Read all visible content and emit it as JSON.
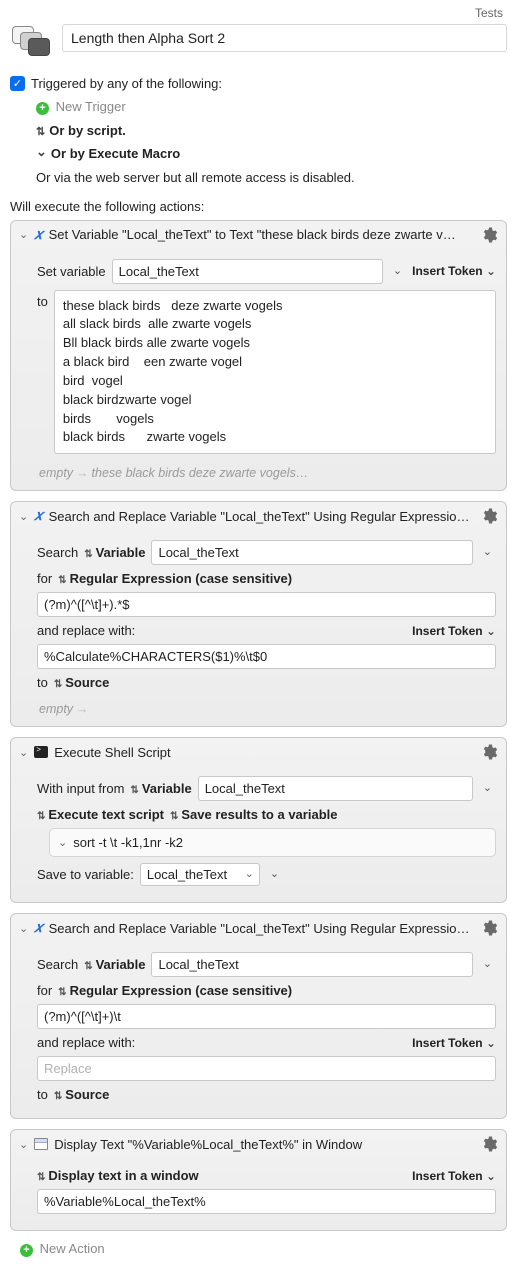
{
  "topbar": {
    "tests": "Tests"
  },
  "macro": {
    "name": "Length then Alpha Sort 2"
  },
  "triggers": {
    "heading": "Triggered by any of the following:",
    "new_trigger": "New Trigger",
    "by_script": "Or by script.",
    "by_execute_macro": "Or by Execute Macro",
    "via_web": "Or via the web server but all remote access is disabled."
  },
  "exec_heading": "Will execute the following actions:",
  "a1": {
    "title": "Set Variable \"Local_theText\" to Text \"these black birds  deze zwarte v…",
    "set_var_label": "Set variable",
    "var_name": "Local_theText",
    "insert_token": "Insert Token",
    "to_label": "to",
    "text": "these black birds   deze zwarte vogels\nall slack birds  alle zwarte vogels\nBll black birds alle zwarte vogels\na black bird    een zwarte vogel\nbird  vogel\nblack birdzwarte vogel\nbirds       vogels\nblack birds      zwarte vogels",
    "preview_empty": "empty",
    "preview_result": "these black birds  deze zwarte vogels…"
  },
  "a2": {
    "title": "Search and Replace Variable \"Local_theText\" Using Regular Expressio…",
    "search_label": "Search",
    "var_selector": "Variable",
    "var_name": "Local_theText",
    "for_label": "for",
    "mode": "Regular Expression (case sensitive)",
    "pattern": "(?m)^([^\\t]+).*$",
    "replace_label": "and replace with:",
    "insert_token": "Insert Token",
    "replacement": "%Calculate%CHARACTERS($1)%\\t$0",
    "to_label": "to",
    "source": "Source",
    "preview_empty": "empty"
  },
  "a3": {
    "title": "Execute Shell Script",
    "with_input_label": "With input from",
    "var_selector": "Variable",
    "var_name": "Local_theText",
    "exec_mode": "Execute text script",
    "save_mode": "Save results to a variable",
    "script": "sort -t \\t -k1,1nr -k2",
    "save_to_label": "Save to variable:",
    "save_to_var": "Local_theText"
  },
  "a4": {
    "title": "Search and Replace Variable \"Local_theText\" Using Regular Expressio…",
    "search_label": "Search",
    "var_selector": "Variable",
    "var_name": "Local_theText",
    "for_label": "for",
    "mode": "Regular Expression (case sensitive)",
    "pattern": "(?m)^([^\\t]+)\\t",
    "replace_label": "and replace with:",
    "insert_token": "Insert Token",
    "replacement_placeholder": "Replace",
    "to_label": "to",
    "source": "Source"
  },
  "a5": {
    "title": "Display Text \"%Variable%Local_theText%\" in Window",
    "mode": "Display text in a window",
    "insert_token": "Insert Token",
    "text": "%Variable%Local_theText%"
  },
  "footer": {
    "new_action": "New Action"
  }
}
